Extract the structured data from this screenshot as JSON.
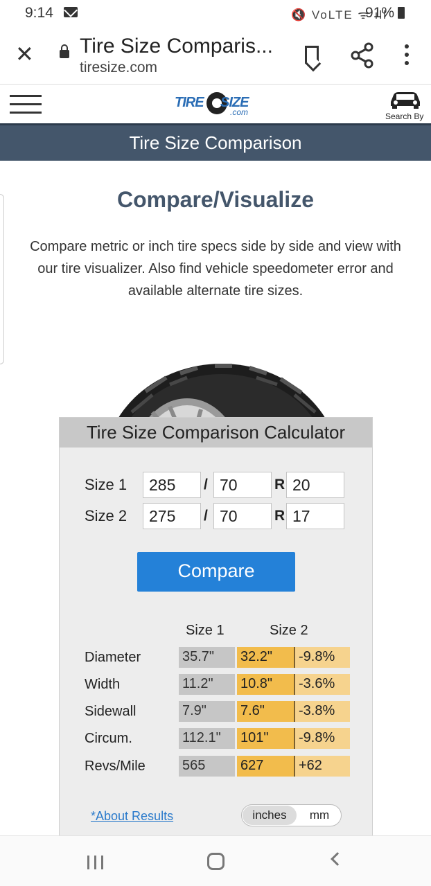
{
  "status_bar": {
    "time": "9:14",
    "system_indicators": "🔇 VoLTE ᯤ ıll",
    "battery": "91%"
  },
  "browser": {
    "page_title": "Tire Size Comparis...",
    "url": "tiresize.com"
  },
  "site_header": {
    "logo": {
      "tire": "TIRE",
      "size": "SIZE",
      "com": ".com"
    },
    "search_by_label": "Search By"
  },
  "banner": {
    "title": "Tire Size Comparison"
  },
  "main": {
    "heading": "Compare/Visualize",
    "intro": "Compare metric or inch tire specs side by side and view with our tire visualizer. Also find vehicle speedometer error and available alternate tire sizes."
  },
  "calculator": {
    "title": "Tire Size Comparison Calculator",
    "size1": {
      "label": "Size 1",
      "width": "285",
      "sep": "/",
      "aspect": "70",
      "r": "R",
      "rim": "20"
    },
    "size2": {
      "label": "Size 2",
      "width": "275",
      "sep": "/",
      "aspect": "70",
      "r": "R",
      "rim": "17"
    },
    "compare_label": "Compare",
    "results": {
      "col_size1": "Size 1",
      "col_size2": "Size 2",
      "rows": [
        {
          "label": "Diameter",
          "s1": "35.7\"",
          "s2": "32.2\"",
          "diff": "-9.8%"
        },
        {
          "label": "Width",
          "s1": "11.2\"",
          "s2": "10.8\"",
          "diff": "-3.6%"
        },
        {
          "label": "Sidewall",
          "s1": "7.9\"",
          "s2": "7.6\"",
          "diff": "-3.8%"
        },
        {
          "label": "Circum.",
          "s1": "112.1\"",
          "s2": "101\"",
          "diff": "-9.8%"
        },
        {
          "label": "Revs/Mile",
          "s1": "565",
          "s2": "627",
          "diff": "+62"
        }
      ]
    },
    "about_link": "*About Results",
    "units": {
      "inches": "inches",
      "mm": "mm",
      "selected": "inches"
    }
  },
  "colors": {
    "banner": "#44566b",
    "compare_button": "#2481d8",
    "size2_cell": "#f2bc4c",
    "diff_cell": "#f6d38e",
    "size1_cell": "#c6c6c6"
  }
}
